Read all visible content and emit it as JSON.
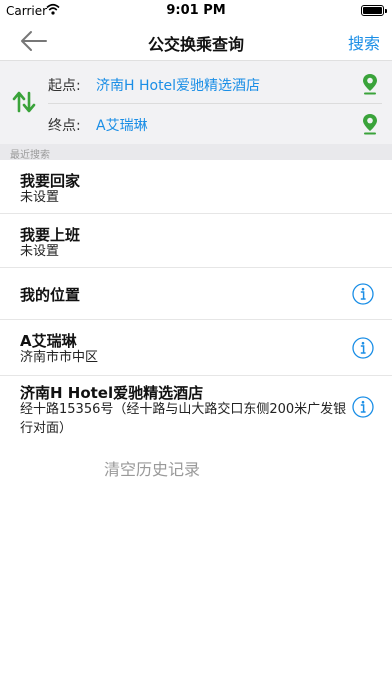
{
  "status_bar": {
    "carrier": "Carrier",
    "time": "9:01 PM"
  },
  "nav": {
    "title": "公交换乘查询",
    "search_label": "搜索"
  },
  "route": {
    "start_label": "起点:",
    "start_value": "济南H Hotel爱驰精选酒店",
    "end_label": "终点:",
    "end_value": "A艾瑞琳"
  },
  "recent": {
    "header": "最近搜索",
    "items": [
      {
        "title": "我要回家",
        "subtitle": "未设置"
      },
      {
        "title": "我要上班",
        "subtitle": "未设置"
      },
      {
        "title": "我的位置",
        "subtitle": ""
      },
      {
        "title": "A艾瑞琳",
        "subtitle": "济南市市中区"
      },
      {
        "title": "济南H Hotel爱驰精选酒店",
        "subtitle": "经十路15356号（经十路与山大路交口东侧200米广发银行对面）"
      }
    ]
  },
  "clear_label": "清空历史记录",
  "colors": {
    "accent": "#1a8ee6",
    "green": "#3aa33a"
  }
}
